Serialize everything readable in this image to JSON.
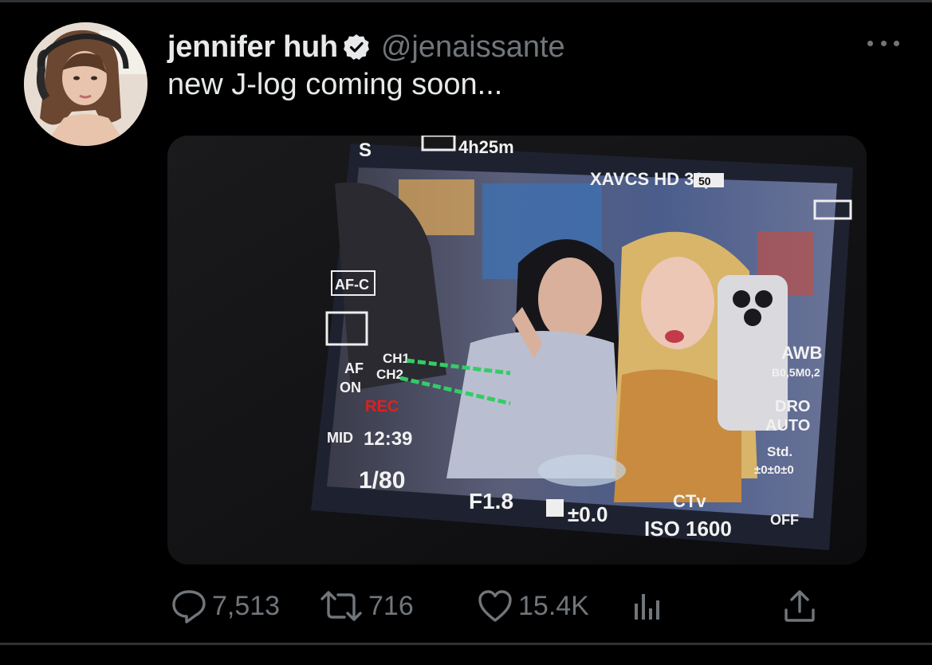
{
  "tweet": {
    "display_name": "jennifer huh",
    "handle": "@jenaissante",
    "text": "new J-log coming soon..."
  },
  "media": {
    "overlay": {
      "batt_top": "4h25m",
      "format": "XAVCS HD 30p",
      "bitrate": "50",
      "focus_mode": "AF-C",
      "ch1": "CH1",
      "ch2": "CH2",
      "face_af": "AF",
      "face_af_state": "ON",
      "rec": "REC",
      "level": "MID",
      "timecode": "12:39",
      "shutter": "1/80",
      "aperture": "F1.8",
      "exposure_comp": "±0.0",
      "iso": "ISO 1600",
      "wb": "AWB",
      "wb_shift": "B0,5M0,2",
      "dro_label": "DRO",
      "dro_value": "AUTO",
      "style": "Std.",
      "style_values": "±0±0±0",
      "creative": "OFF"
    }
  },
  "actions": {
    "replies": "7,513",
    "retweets": "716",
    "likes": "15.4K"
  },
  "colors": {
    "background": "#000000",
    "text_primary": "#e7e9ea",
    "text_secondary": "#71767b",
    "rule": "#2f3336",
    "rec_red": "#e02020",
    "meter_green": "#33cc66"
  },
  "icons": {
    "verified": "verified-badge-icon",
    "more": "more-dots-icon",
    "reply": "reply-bubble-icon",
    "retweet": "retweet-icon",
    "like": "heart-icon",
    "views": "views-bars-icon",
    "share": "share-upload-icon"
  }
}
